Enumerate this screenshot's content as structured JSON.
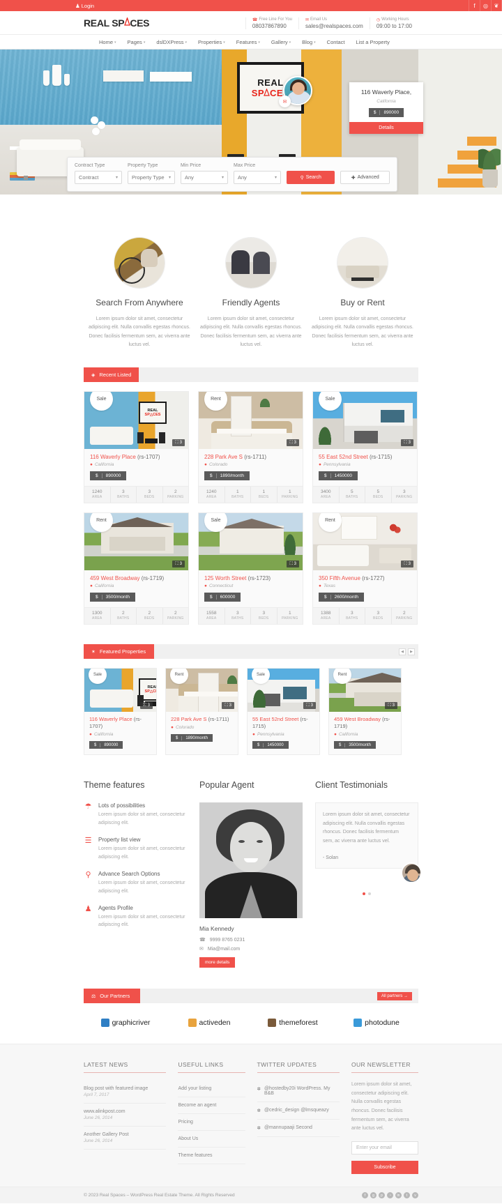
{
  "topbar": {
    "login_label": "Login",
    "login_icon": "user-icon",
    "socials": [
      {
        "name": "facebook-icon",
        "glyph": "f"
      },
      {
        "name": "instagram-icon",
        "glyph": "◎"
      },
      {
        "name": "twitter-icon",
        "glyph": "❦"
      }
    ],
    "bg_color": "#f0514a"
  },
  "header": {
    "logo_part1": "REAL SP",
    "logo_part2": "CES",
    "info": [
      {
        "icon": "phone-icon",
        "label": "Free Line For You",
        "value": "08037867890"
      },
      {
        "icon": "envelope-icon",
        "label": "Email Us",
        "value": "sales@realspaces.com"
      },
      {
        "icon": "clock-icon",
        "label": "Working Hours",
        "value": "09:00 to 17:00"
      }
    ]
  },
  "nav": {
    "items": [
      {
        "label": "Home",
        "caret": true
      },
      {
        "label": "Pages",
        "caret": true
      },
      {
        "label": "dslDXPress",
        "caret": true
      },
      {
        "label": "Properties",
        "caret": true
      },
      {
        "label": "Features",
        "caret": true
      },
      {
        "label": "Gallery",
        "caret": true
      },
      {
        "label": "Blog",
        "caret": true
      },
      {
        "label": "Contact",
        "caret": false
      },
      {
        "label": "List a Property",
        "caret": false
      }
    ]
  },
  "hero": {
    "frame_line1": "REAL",
    "frame_line2_a": "SP",
    "frame_line2_b": "CES",
    "card": {
      "title": "116 Waverly Place,",
      "location": "California",
      "currency": "$",
      "price": "890000",
      "button_label": "Details"
    },
    "mail_icon": "envelope-icon",
    "agent_avatar": "agent-avatar"
  },
  "search": {
    "fields": [
      {
        "label": "Contract Type",
        "value": "Contract",
        "name": "contract-type-select"
      },
      {
        "label": "Property Type",
        "value": "Property Type",
        "name": "property-type-select"
      },
      {
        "label": "Min Price",
        "value": "Any",
        "name": "min-price-select"
      },
      {
        "label": "Max Price",
        "value": "Any",
        "name": "max-price-select"
      }
    ],
    "search_label": "Search",
    "search_icon": "search-icon",
    "advanced_label": "Advanced",
    "advanced_icon": "plus-icon"
  },
  "services": [
    {
      "title": "Search From Anywhere",
      "text": "Lorem ipsum dolor sit amet, consectetur adipiscing elit. Nulla convallis egestas rhoncus. Donec facilisis fermentum sem, ac viverra ante luctus vel.",
      "image": "cyclist-photo"
    },
    {
      "title": "Friendly Agents",
      "text": "Lorem ipsum dolor sit amet, consectetur adipiscing elit. Nulla convallis egestas rhoncus. Donec facilisis fermentum sem, ac viverra ante luctus vel.",
      "image": "agents-meeting-photo"
    },
    {
      "title": "Buy or Rent",
      "text": "Lorem ipsum dolor sit amet, consectetur adipiscing elit. Nulla convallis egestas rhoncus. Donec facilisis fermentum sem, ac viverra ante luctus vel.",
      "image": "living-room-photo"
    }
  ],
  "recent": {
    "section_title": "Recent Listed",
    "section_icon": "tag-icon",
    "stat_keys": [
      "AREA",
      "BATHS",
      "BEDS",
      "PARKING"
    ],
    "properties": [
      {
        "badge": "Sale",
        "title": "116 Waverly Place",
        "id": "(rs-1707)",
        "location": "California",
        "currency": "$",
        "price": "890000",
        "photos": "3",
        "area": "1240",
        "baths": "3",
        "beds": "3",
        "parking": "2",
        "image": "img-living"
      },
      {
        "badge": "Rent",
        "title": "228 Park Ave S",
        "id": "(rs-1711)",
        "location": "Colorado",
        "currency": "$",
        "price": "1890/month",
        "photos": "3",
        "area": "1240",
        "baths": "1",
        "beds": "1",
        "parking": "1",
        "image": "img-bed"
      },
      {
        "badge": "Sale",
        "title": "55 East 52nd Street",
        "id": "(rs-1715)",
        "location": "Pennsylvania",
        "currency": "$",
        "price": "1450000",
        "photos": "3",
        "area": "3400",
        "baths": "5",
        "beds": "5",
        "parking": "3",
        "image": "img-modern"
      },
      {
        "badge": "Rent",
        "title": "459 West Broadway",
        "id": "(rs-1719)",
        "location": "California",
        "currency": "$",
        "price": "3500/month",
        "photos": "3",
        "area": "1300",
        "baths": "2",
        "beds": "2",
        "parking": "2",
        "image": "img-bungalow"
      },
      {
        "badge": "Sale",
        "title": "125 Worth Street",
        "id": "(rs-1723)",
        "location": "Connecticut",
        "currency": "$",
        "price": "600000",
        "photos": "3",
        "area": "1558",
        "baths": "3",
        "beds": "3",
        "parking": "1",
        "image": "img-house2"
      },
      {
        "badge": "Rent",
        "title": "350 Fifth Avenue",
        "id": "(rs-1727)",
        "location": "Texas",
        "currency": "$",
        "price": "2600/month",
        "photos": "3",
        "area": "1388",
        "baths": "3",
        "beds": "3",
        "parking": "2",
        "image": "img-interior"
      }
    ]
  },
  "featured": {
    "section_title": "Featured Properties",
    "section_icon": "star-icon",
    "prev_icon": "chevron-left-icon",
    "next_icon": "chevron-right-icon",
    "properties": [
      {
        "badge": "Sale",
        "title": "116 Waverly Place",
        "id": "(rs-1707)",
        "location": "California",
        "currency": "$",
        "price": "890000",
        "photos": "3",
        "image": "img-living"
      },
      {
        "badge": "Rent",
        "title": "228 Park Ave S",
        "id": "(rs-1711)",
        "location": "Colorado",
        "currency": "$",
        "price": "1890/month",
        "photos": "3",
        "image": "img-bed"
      },
      {
        "badge": "Sale",
        "title": "55 East 52nd Street",
        "id": "(rs-1715)",
        "location": "Pennsylvania",
        "currency": "$",
        "price": "1450000",
        "photos": "3",
        "image": "img-modern"
      },
      {
        "badge": "Rent",
        "title": "459 West Broadway",
        "id": "(rs-1719)",
        "location": "California",
        "currency": "$",
        "price": "3500/month",
        "photos": "3",
        "image": "img-bungalow"
      }
    ]
  },
  "theme_features": {
    "title": "Theme features",
    "items": [
      {
        "icon": "umbrella-icon",
        "title": "Lots of possibilities",
        "text": "Lorem ipsum dolor sit amet, consectetur adipiscing elit."
      },
      {
        "icon": "list-icon",
        "title": "Property list view",
        "text": "Lorem ipsum dolor sit amet, consectetur adipiscing elit."
      },
      {
        "icon": "search-icon",
        "title": "Advance Search Options",
        "text": "Lorem ipsum dolor sit amet, consectetur adipiscing elit."
      },
      {
        "icon": "users-icon",
        "title": "Agents Profile",
        "text": "Lorem ipsum dolor sit amet, consectetur adipiscing elit."
      }
    ]
  },
  "popular_agent": {
    "title": "Popular Agent",
    "name": "Mia Kennedy",
    "phone": "9999 8765 0231",
    "phone_icon": "phone-icon",
    "email": "Mia@mail.com",
    "email_icon": "envelope-icon",
    "button_label": "more details"
  },
  "testimonials": {
    "title": "Client Testimonials",
    "text": "Lorem ipsum dolor sit amet, consectetur adipiscing elit. Nulla convallis egestas rhoncus. Donec facilisis fermentum sem, ac viverra ante luctus vel.",
    "author": "- Solan",
    "dots": 2,
    "active_dot": 0
  },
  "partners": {
    "section_title": "Our Partners",
    "section_icon": "gift-icon",
    "all_label": "All partners →",
    "logos": [
      {
        "name": "graphicriver-logo",
        "label": "graphicriver"
      },
      {
        "name": "activeden-logo",
        "label": "activeden"
      },
      {
        "name": "themeforest-logo",
        "label": "themeforest"
      },
      {
        "name": "photodune-logo",
        "label": "photodune"
      }
    ]
  },
  "footer": {
    "latest_news": {
      "title": "LATEST NEWS",
      "items": [
        {
          "title": "Blog post with featured image",
          "date": "April 7, 2017"
        },
        {
          "title": "www.alinkpost.com",
          "date": "June 26, 2014"
        },
        {
          "title": "Another Gallery Post",
          "date": "June 26, 2014"
        }
      ]
    },
    "useful_links": {
      "title": "USEFUL LINKS",
      "items": [
        "Add your listing",
        "Become an agent",
        "Pricing",
        "About Us",
        "Theme features"
      ]
    },
    "twitter": {
      "title": "TWITTER UPDATES",
      "items": [
        "@hostedby20i WordPress. My B&B",
        "@cedric_design @lmsqueazy",
        "@mannupaaji Second"
      ]
    },
    "newsletter": {
      "title": "OUR NEWSLETTER",
      "text": "Lorem ipsum dolor sit amet, consectetur adipiscing elit. Nulla convallis egestas rhoncus. Donec facilisis fermentum sem, ac viverra ante luctus vel.",
      "placeholder": "Enter your email",
      "button_label": "Subscribe"
    },
    "copyright": "© 2023 Real Spaces – WordPress Real Estate Theme. All Rights Reserved",
    "socials": [
      {
        "name": "facebook-icon",
        "glyph": "f"
      },
      {
        "name": "google-plus-icon",
        "glyph": "g"
      },
      {
        "name": "pinterest-icon",
        "glyph": "p"
      },
      {
        "name": "rss-icon",
        "glyph": "◔"
      },
      {
        "name": "linkedin-icon",
        "glyph": "in"
      },
      {
        "name": "twitter-icon",
        "glyph": "t"
      },
      {
        "name": "vimeo-icon",
        "glyph": "v"
      }
    ]
  },
  "accent_color": "#f0514a"
}
